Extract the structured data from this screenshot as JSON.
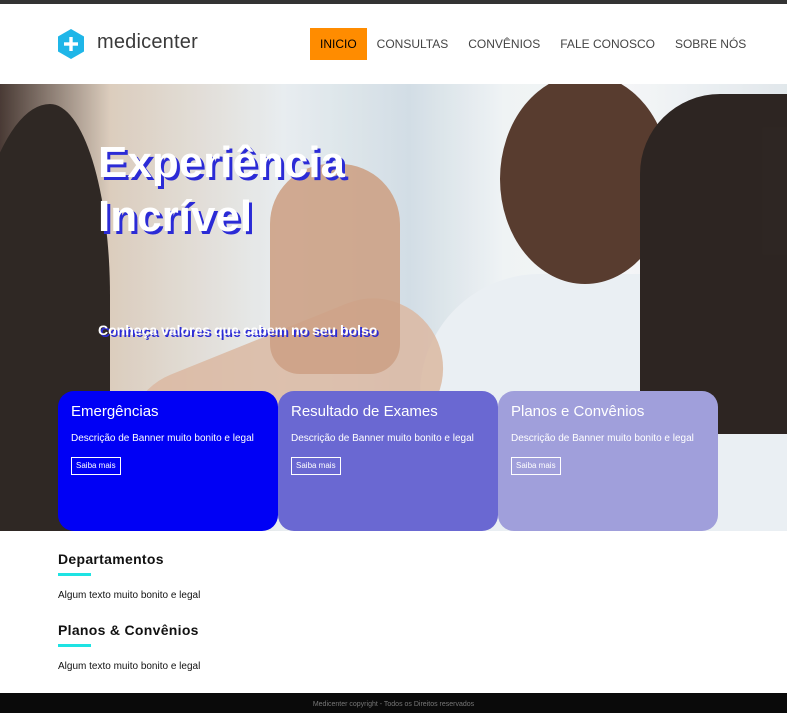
{
  "brand": {
    "name": "medicenter",
    "accent": "#1fb6e8"
  },
  "nav": {
    "items": [
      {
        "label": "INICIO",
        "active": true
      },
      {
        "label": "CONSULTAS"
      },
      {
        "label": "CONVÊNIOS"
      },
      {
        "label": "FALE CONOSCO"
      },
      {
        "label": "SOBRE NÓS"
      }
    ],
    "active_color": "#ff8c00"
  },
  "hero": {
    "title_line1": "Experiência",
    "title_line2": "Incrível",
    "subtitle": "Conheça valores que cabem no seu bolso"
  },
  "cards": [
    {
      "title": "Emergências",
      "description": "Descrição de Banner muito bonito e legal",
      "button": "Saiba mais",
      "color": "#0000f5"
    },
    {
      "title": "Resultado de Exames",
      "description": "Descrição de Banner muito bonito e legal",
      "button": "Saiba mais",
      "color": "#6a68d2"
    },
    {
      "title": "Planos e Convênios",
      "description": "Descrição de Banner muito bonito e legal",
      "button": "Saiba mais",
      "color": "#a09fdb"
    }
  ],
  "sections": [
    {
      "title": "Departamentos",
      "text": "Algum texto muito bonito e legal"
    },
    {
      "title": "Planos & Convênios",
      "text": "Algum texto muito bonito e legal"
    }
  ],
  "footer": {
    "text": "Medicenter copyright - Todos os Direitos reservados"
  }
}
